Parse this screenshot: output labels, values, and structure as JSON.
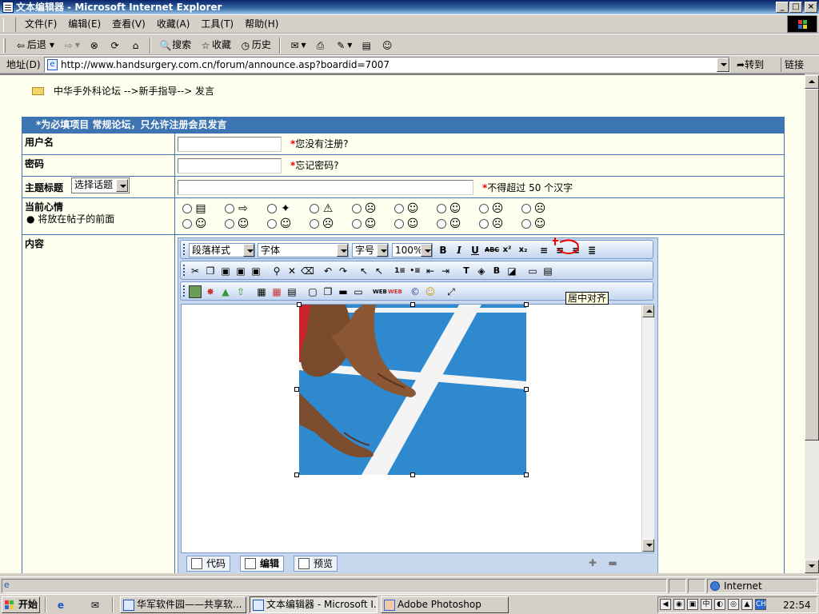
{
  "window": {
    "title": "文本编辑器 - Microsoft Internet Explorer",
    "min_glyph": "_",
    "max_glyph": "□",
    "close_glyph": "×"
  },
  "menu": [
    "文件(F)",
    "编辑(E)",
    "查看(V)",
    "收藏(A)",
    "工具(T)",
    "帮助(H)"
  ],
  "toolbar": {
    "back": "后退",
    "search": "搜索",
    "favorites": "收藏",
    "history": "历史"
  },
  "address": {
    "label": "地址(D)",
    "url": "http://www.handsurgery.com.cn/forum/announce.asp?boardid=7007",
    "go": "转到",
    "links": "链接"
  },
  "breadcrumb": "中华手外科论坛 -->新手指导--> 发言",
  "form": {
    "header": "*为必填项目 常规论坛，只允许注册会员发言",
    "username": {
      "label": "用户名",
      "value": "",
      "note": "您没有注册?"
    },
    "password": {
      "label": "密码",
      "value": "",
      "note": "忘记密码?"
    },
    "subject": {
      "label": "主题标题",
      "select": "选择话题",
      "value": "",
      "note": "不得超过 50 个汉字"
    },
    "mood": {
      "label": "当前心情",
      "hint": "将放在帖子的前面"
    },
    "content": {
      "label": "内容"
    }
  },
  "editor": {
    "paragraph_style": "段落样式",
    "font": "字体",
    "size": "字号",
    "zoom": "100%",
    "tooltip": "居中对齐",
    "modes": [
      "代码",
      "编辑",
      "预览"
    ]
  },
  "status": {
    "zone": "Internet"
  },
  "taskbar": {
    "start": "开始",
    "tasks": [
      "华军软件园——共享软...",
      "文本编辑器 - Microsoft I...",
      "Adobe Photoshop"
    ],
    "lang": "CH",
    "clock": "22:54"
  },
  "icons": {
    "title": "ie-page-icon",
    "back": "back-arrow-icon",
    "forward": "forward-arrow-icon",
    "stop": "stop-icon",
    "refresh": "refresh-icon",
    "home": "home-icon",
    "search": "search-icon",
    "favorites": "favorites-icon",
    "history": "history-icon",
    "mail": "mail-icon",
    "print": "print-icon",
    "edit": "edit-icon",
    "messenger": "messenger-icon"
  },
  "colors": {
    "title_bar": "#0a246a",
    "form_border": "#3d75b3",
    "page_bg": "#fffff0",
    "required": "#e00000",
    "editor_bg": "#c6d7ee"
  }
}
